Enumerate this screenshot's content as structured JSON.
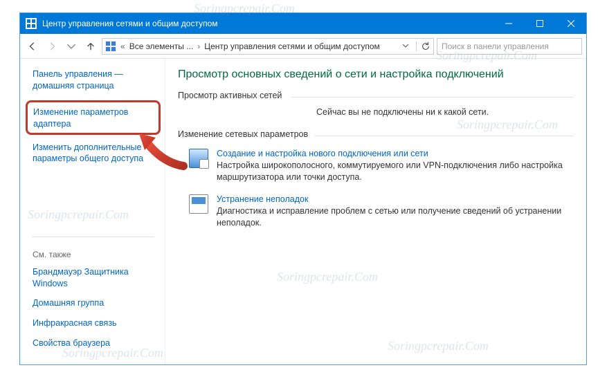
{
  "window": {
    "title": "Центр управления сетями и общим доступом"
  },
  "nav": {
    "breadcrumb_prefix": "«",
    "breadcrumb1": "Все элементы ...",
    "breadcrumb2": "Центр управления сетями и общим доступом",
    "search_placeholder": "Поиск в панели управления"
  },
  "sidebar": {
    "home": "Панель управления — домашняя страница",
    "adapter": "Изменение параметров адаптера",
    "sharing": "Изменить дополнительные параметры общего доступа",
    "see_also": "См. также",
    "firewall": "Брандмауэр Защитника Windows",
    "homegroup": "Домашняя группа",
    "infrared": "Инфракрасная связь",
    "browser": "Свойства браузера"
  },
  "main": {
    "heading": "Просмотр основных сведений о сети и настройка подключений",
    "active_label": "Просмотр активных сетей",
    "active_text": "Сейчас вы не подключены ни к какой сети.",
    "change_label": "Изменение сетевых параметров",
    "setup_link": "Создание и настройка нового подключения или сети",
    "setup_desc": "Настройка широкополосного, коммутируемого или VPN-подключения либо настройка маршрутизатора или точки доступа.",
    "troub_link": "Устранение неполадок",
    "troub_desc": "Диагностика и исправление проблем с сетью или получение сведений об устранении неполадок."
  },
  "watermark": "Soringpcrepair.Com"
}
